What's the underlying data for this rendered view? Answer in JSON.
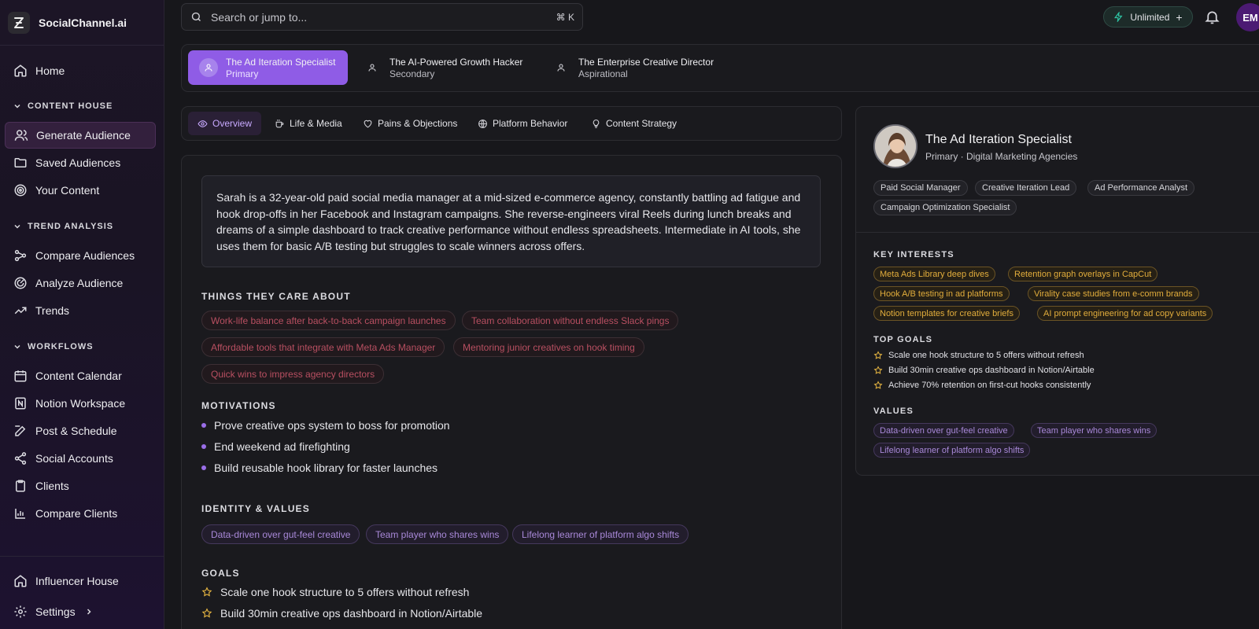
{
  "app": {
    "name": "SocialChannel.ai"
  },
  "sidebar": {
    "home": "Home",
    "content_house": {
      "title": "CONTENT HOUSE",
      "items": [
        "Generate Audience",
        "Saved Audiences",
        "Your Content"
      ]
    },
    "trend_analysis": {
      "title": "TREND ANALYSIS",
      "items": [
        "Compare Audiences",
        "Analyze Audience",
        "Trends"
      ]
    },
    "workflows": {
      "title": "WORKFLOWS",
      "items": [
        "Content Calendar",
        "Notion Workspace",
        "Post & Schedule",
        "Social Accounts",
        "Clients",
        "Compare Clients"
      ]
    },
    "influencer_house": "Influencer House",
    "settings": "Settings"
  },
  "topbar": {
    "search_placeholder": "Search or jump to...",
    "search_shortcut": "⌘ K",
    "plan_label": "Unlimited",
    "user_initials": "EM"
  },
  "personas": [
    {
      "title": "The Ad Iteration Specialist",
      "subtitle": "Primary"
    },
    {
      "title": "The AI-Powered Growth Hacker",
      "subtitle": "Secondary"
    },
    {
      "title": "The Enterprise Creative Director",
      "subtitle": "Aspirational"
    }
  ],
  "tabs": [
    "Overview",
    "Life & Media",
    "Pains & Objections",
    "Platform Behavior",
    "Content Strategy"
  ],
  "overview": {
    "description": "Sarah is a 32-year-old paid social media manager at a mid-sized e-commerce agency, constantly battling ad fatigue and hook drop-offs in her Facebook and Instagram campaigns. She reverse-engineers viral Reels during lunch breaks and dreams of a simple dashboard to track creative performance without endless spreadsheets. Intermediate in AI tools, she uses them for basic A/B testing but struggles to scale winners across offers.",
    "things_title": "THINGS THEY CARE ABOUT",
    "things": [
      "Work-life balance after back-to-back campaign launches",
      "Team collaboration without endless Slack pings",
      "Affordable tools that integrate with Meta Ads Manager",
      "Mentoring junior creatives on hook timing",
      "Quick wins to impress agency directors"
    ],
    "motivations_title": "MOTIVATIONS",
    "motivations": [
      "Prove creative ops system to boss for promotion",
      "End weekend ad firefighting",
      "Build reusable hook library for faster launches"
    ],
    "identity_title": "IDENTITY & VALUES",
    "identity": [
      "Data-driven over gut-feel creative",
      "Team player who shares wins",
      "Lifelong learner of platform algo shifts"
    ],
    "goals_title": "GOALS",
    "goals": [
      "Scale one hook structure to 5 offers without refresh",
      "Build 30min creative ops dashboard in Notion/Airtable"
    ]
  },
  "profile": {
    "name": "The Ad Iteration Specialist",
    "subtitle": "Primary · Digital Marketing Agencies",
    "roles": [
      "Paid Social Manager",
      "Creative Iteration Lead",
      "Ad Performance Analyst",
      "Campaign Optimization Specialist"
    ],
    "interests_title": "KEY INTERESTS",
    "interests": [
      "Meta Ads Library deep dives",
      "Retention graph overlays in CapCut",
      "Hook A/B testing in ad platforms",
      "Virality case studies from e-comm brands",
      "Notion templates for creative briefs",
      "AI prompt engineering for ad copy variants"
    ],
    "goals_title": "TOP GOALS",
    "goals": [
      "Scale one hook structure to 5 offers without refresh",
      "Build 30min creative ops dashboard in Notion/Airtable",
      "Achieve 70% retention on first-cut hooks consistently"
    ],
    "values_title": "VALUES",
    "values": [
      "Data-driven over gut-feel creative",
      "Team player who shares wins",
      "Lifelong learner of platform algo shifts"
    ]
  },
  "colors": {
    "accent": "#8f5ce6",
    "care_chip": "#b84f61",
    "interest_chip": "#e2ad3c",
    "value_chip": "#a989d9",
    "plan_badge": "#2ec4a4"
  }
}
